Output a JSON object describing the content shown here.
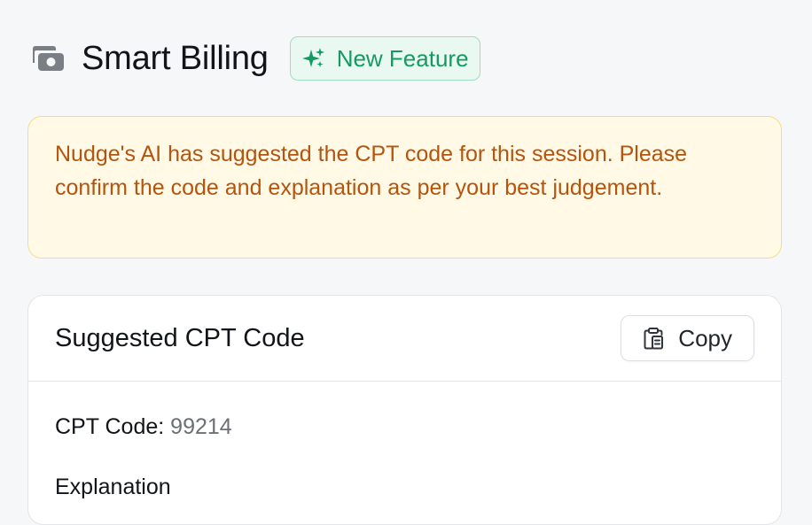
{
  "header": {
    "icon": "billing-photo-stack-icon",
    "title": "Smart Billing",
    "badge": {
      "icon": "sparkles-icon",
      "label": "New Feature"
    }
  },
  "alert": {
    "message": "Nudge's AI has suggested the CPT code for this session. Please confirm the code and explanation as per your best judgement."
  },
  "card": {
    "title": "Suggested CPT Code",
    "copy_button": {
      "icon": "clipboard-copy-icon",
      "label": "Copy"
    },
    "cpt_code_label": "CPT Code:",
    "cpt_code_value": "99214",
    "explanation_label": "Explanation"
  },
  "colors": {
    "badge_green": "#159a63",
    "alert_text": "#b5540d",
    "alert_bg": "#fff9e6"
  }
}
